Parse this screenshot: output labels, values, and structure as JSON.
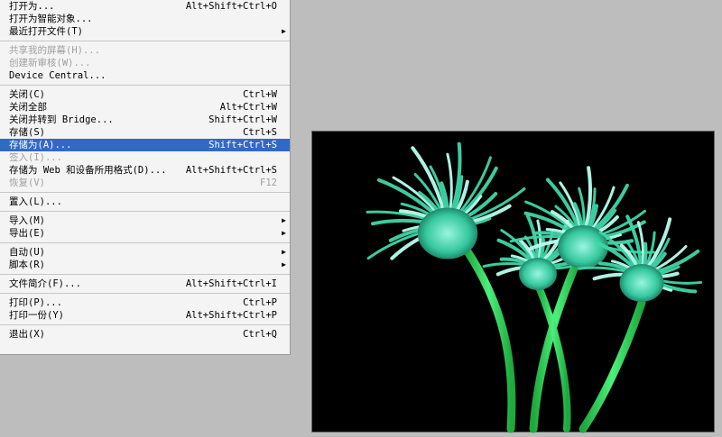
{
  "menu": {
    "items": [
      {
        "label": "打开为...",
        "shortcut": "Alt+Shift+Ctrl+O"
      },
      {
        "label": "打开为智能对象..."
      },
      {
        "label": "最近打开文件(T)",
        "submenu": true
      },
      {
        "separator": true
      },
      {
        "label": "共享我的屏幕(H)...",
        "disabled": true
      },
      {
        "label": "创建新审核(W)...",
        "disabled": true
      },
      {
        "label": "Device Central..."
      },
      {
        "separator": true
      },
      {
        "label": "关闭(C)",
        "shortcut": "Ctrl+W"
      },
      {
        "label": "关闭全部",
        "shortcut": "Alt+Ctrl+W"
      },
      {
        "label": "关闭并转到 Bridge...",
        "shortcut": "Shift+Ctrl+W"
      },
      {
        "label": "存储(S)",
        "shortcut": "Ctrl+S"
      },
      {
        "label": "存储为(A)...",
        "shortcut": "Shift+Ctrl+S",
        "highlighted": true
      },
      {
        "label": "签入(I)...",
        "disabled": true
      },
      {
        "label": "存储为 Web 和设备所用格式(D)...",
        "shortcut": "Alt+Shift+Ctrl+S"
      },
      {
        "label": "恢复(V)",
        "shortcut": "F12",
        "disabled": true
      },
      {
        "separator": true
      },
      {
        "label": "置入(L)..."
      },
      {
        "separator": true
      },
      {
        "label": "导入(M)",
        "submenu": true
      },
      {
        "label": "导出(E)",
        "submenu": true
      },
      {
        "separator": true
      },
      {
        "label": "自动(U)",
        "submenu": true
      },
      {
        "label": "脚本(R)",
        "submenu": true
      },
      {
        "separator": true
      },
      {
        "label": "文件简介(F)...",
        "shortcut": "Alt+Shift+Ctrl+I"
      },
      {
        "separator": true
      },
      {
        "label": "打印(P)...",
        "shortcut": "Ctrl+P"
      },
      {
        "label": "打印一份(Y)",
        "shortcut": "Alt+Shift+Ctrl+P"
      },
      {
        "separator": true
      },
      {
        "label": "退出(X)",
        "shortcut": "Ctrl+Q"
      }
    ]
  },
  "colors": {
    "menu_bg": "#f4f4f4",
    "highlight": "#316ac5",
    "disabled_text": "#a0a0a0",
    "workspace": "#bdbdbd",
    "flower_petal": "#3fe0b0",
    "flower_stem": "#2fd35a"
  },
  "icons": {
    "submenu_arrow": "triangle-right-icon"
  },
  "image": {
    "subject": "green-flowers-on-black"
  }
}
